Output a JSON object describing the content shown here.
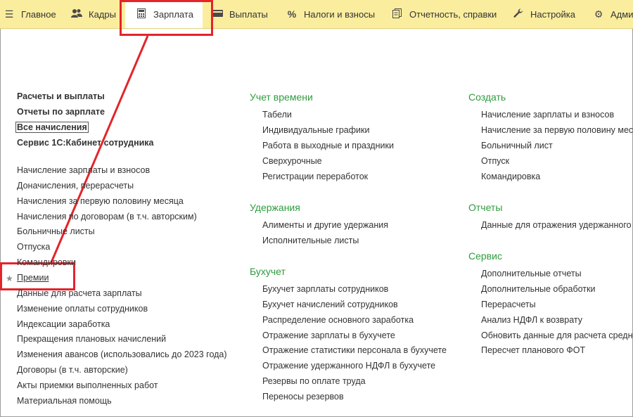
{
  "topbar": {
    "tabs": [
      {
        "label": "Главное",
        "icon": "hamburger-icon"
      },
      {
        "label": "Кадры",
        "icon": "people-icon"
      },
      {
        "label": "Зарплата",
        "icon": "calculator-icon"
      },
      {
        "label": "Выплаты",
        "icon": "wallet-icon"
      },
      {
        "label": "Налоги и взносы",
        "icon": "percent-icon"
      },
      {
        "label": "Отчетность, справки",
        "icon": "documents-icon"
      },
      {
        "label": "Настройка",
        "icon": "wrench-icon"
      },
      {
        "label": "Адми",
        "icon": "gear-icon"
      }
    ]
  },
  "left": {
    "top_links": [
      "Расчеты и выплаты",
      "Отчеты по зарплате",
      "Все начисления",
      "Сервис 1С:Кабинет сотрудника"
    ],
    "items": [
      "Начисление зарплаты и взносов",
      "Доначисления, перерасчеты",
      "Начисления за первую половину месяца",
      "Начисления по договорам (в т.ч. авторским)",
      "Больничные листы",
      "Отпуска",
      "Командировки",
      "Премии",
      "Данные для расчета зарплаты",
      "Изменение оплаты сотрудников",
      "Индексации заработка",
      "Прекращения плановых начислений",
      "Изменения авансов (использовались до 2023 года)",
      "Договоры (в т.ч. авторские)",
      "Акты приемки выполненных работ",
      "Материальная помощь"
    ]
  },
  "middle": {
    "sections": [
      {
        "title": "Учет времени",
        "items": [
          "Табели",
          "Индивидуальные графики",
          "Работа в выходные и праздники",
          "Сверхурочные",
          "Регистрации переработок"
        ]
      },
      {
        "title": "Удержания",
        "items": [
          "Алименты и другие удержания",
          "Исполнительные листы"
        ]
      },
      {
        "title": "Бухучет",
        "items": [
          "Бухучет зарплаты сотрудников",
          "Бухучет начислений сотрудников",
          "Распределение основного заработка",
          "Отражение зарплаты в бухучете",
          "Отражение статистики персонала в бухучете",
          "Отражение удержанного НДФЛ в бухучете",
          "Резервы по оплате труда",
          "Переносы резервов"
        ]
      }
    ]
  },
  "right": {
    "sections": [
      {
        "title": "Создать",
        "items": [
          "Начисление зарплаты и взносов",
          "Начисление за первую половину меся",
          "Больничный лист",
          "Отпуск",
          "Командировка"
        ]
      },
      {
        "title": "Отчеты",
        "items": [
          "Данные для отражения удержанного Н"
        ]
      },
      {
        "title": "Сервис",
        "items": [
          "Дополнительные отчеты",
          "Дополнительные обработки",
          "Перерасчеты",
          "Анализ НДФЛ к возврату",
          "Обновить данные для расчета средне",
          "Пересчет планового ФОТ"
        ]
      }
    ]
  },
  "colors": {
    "topbar_bg": "#fbed9e",
    "section_title": "#2e9c3e",
    "highlight": "#e3242b",
    "text": "#333333"
  }
}
